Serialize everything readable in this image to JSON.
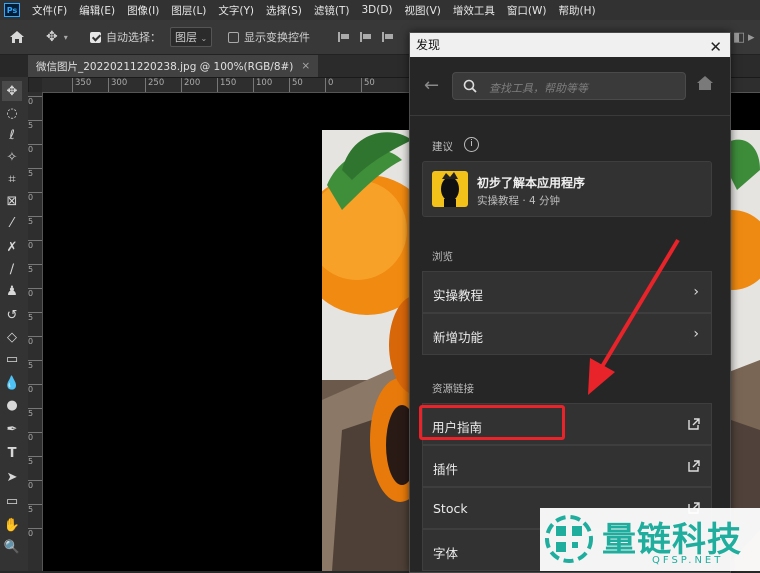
{
  "menubar": {
    "logo": "Ps",
    "items": [
      "文件(F)",
      "编辑(E)",
      "图像(I)",
      "图层(L)",
      "文字(Y)",
      "选择(S)",
      "滤镜(T)",
      "3D(D)",
      "视图(V)",
      "增效工具",
      "窗口(W)",
      "帮助(H)"
    ]
  },
  "options": {
    "auto_select_label": "自动选择：",
    "layer_select": "图层",
    "show_transform_label": "显示变换控件"
  },
  "document": {
    "tab_title": "微信图片_20220211220238.jpg @ 100%(RGB/8#)",
    "close_glyph": "×"
  },
  "ruler": {
    "h_ticks": [
      "350",
      "300",
      "250",
      "200",
      "150",
      "100",
      "50",
      "0",
      "50"
    ],
    "v_ticks": [
      "0",
      "5",
      "0",
      "5",
      "0",
      "5",
      "0",
      "5",
      "0",
      "5",
      "0",
      "5",
      "0",
      "5",
      "0",
      "5",
      "0",
      "5",
      "0"
    ]
  },
  "panel": {
    "title": "发现",
    "search_placeholder": "查找工具，帮助等等",
    "suggest_header": "建议",
    "suggest_card": {
      "title": "初步了解本应用程序",
      "subtitle": "实操教程 · 4 分钟"
    },
    "browse_header": "浏览",
    "browse_items": [
      "实操教程",
      "新增功能"
    ],
    "resources_header": "资源链接",
    "resource_items": [
      "用户指南",
      "插件",
      "Stock",
      "字体"
    ]
  },
  "colors": {
    "highlight": "#e8232a",
    "arrow": "#e8232a",
    "panel_bg": "#262626",
    "watermark": "#1fae9e"
  },
  "watermark": {
    "brand": "量链科技",
    "url": "QFSP.NET"
  }
}
